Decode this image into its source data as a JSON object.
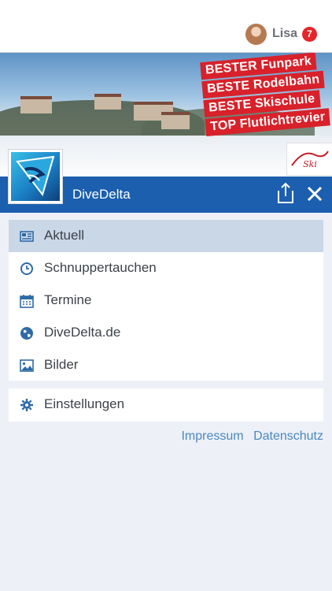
{
  "user": {
    "name": "Lisa",
    "notifications": "7"
  },
  "banner": {
    "promo_lines": [
      "BESTER Funpark",
      "BESTE Rodelbahn",
      "BESTE Skischule",
      "TOP Flutlichtrevier"
    ],
    "sponsor_logo_text": "Skiarena"
  },
  "app": {
    "title": "DiveDelta"
  },
  "menu": {
    "items": [
      {
        "label": "Aktuell",
        "icon": "news-icon",
        "active": true
      },
      {
        "label": "Schnuppertauchen",
        "icon": "clock-icon",
        "active": false
      },
      {
        "label": "Termine",
        "icon": "calendar-icon",
        "active": false
      },
      {
        "label": "DiveDelta.de",
        "icon": "globe-icon",
        "active": false
      },
      {
        "label": "Bilder",
        "icon": "image-icon",
        "active": false
      }
    ],
    "settings": {
      "label": "Einstellungen",
      "icon": "gear-icon"
    }
  },
  "footer": {
    "impressum": "Impressum",
    "datenschutz": "Datenschutz"
  },
  "colors": {
    "accent": "#1b5fae",
    "icon": "#2f6aa7",
    "active_bg": "#c9d7e7",
    "badge": "#e5252b"
  }
}
